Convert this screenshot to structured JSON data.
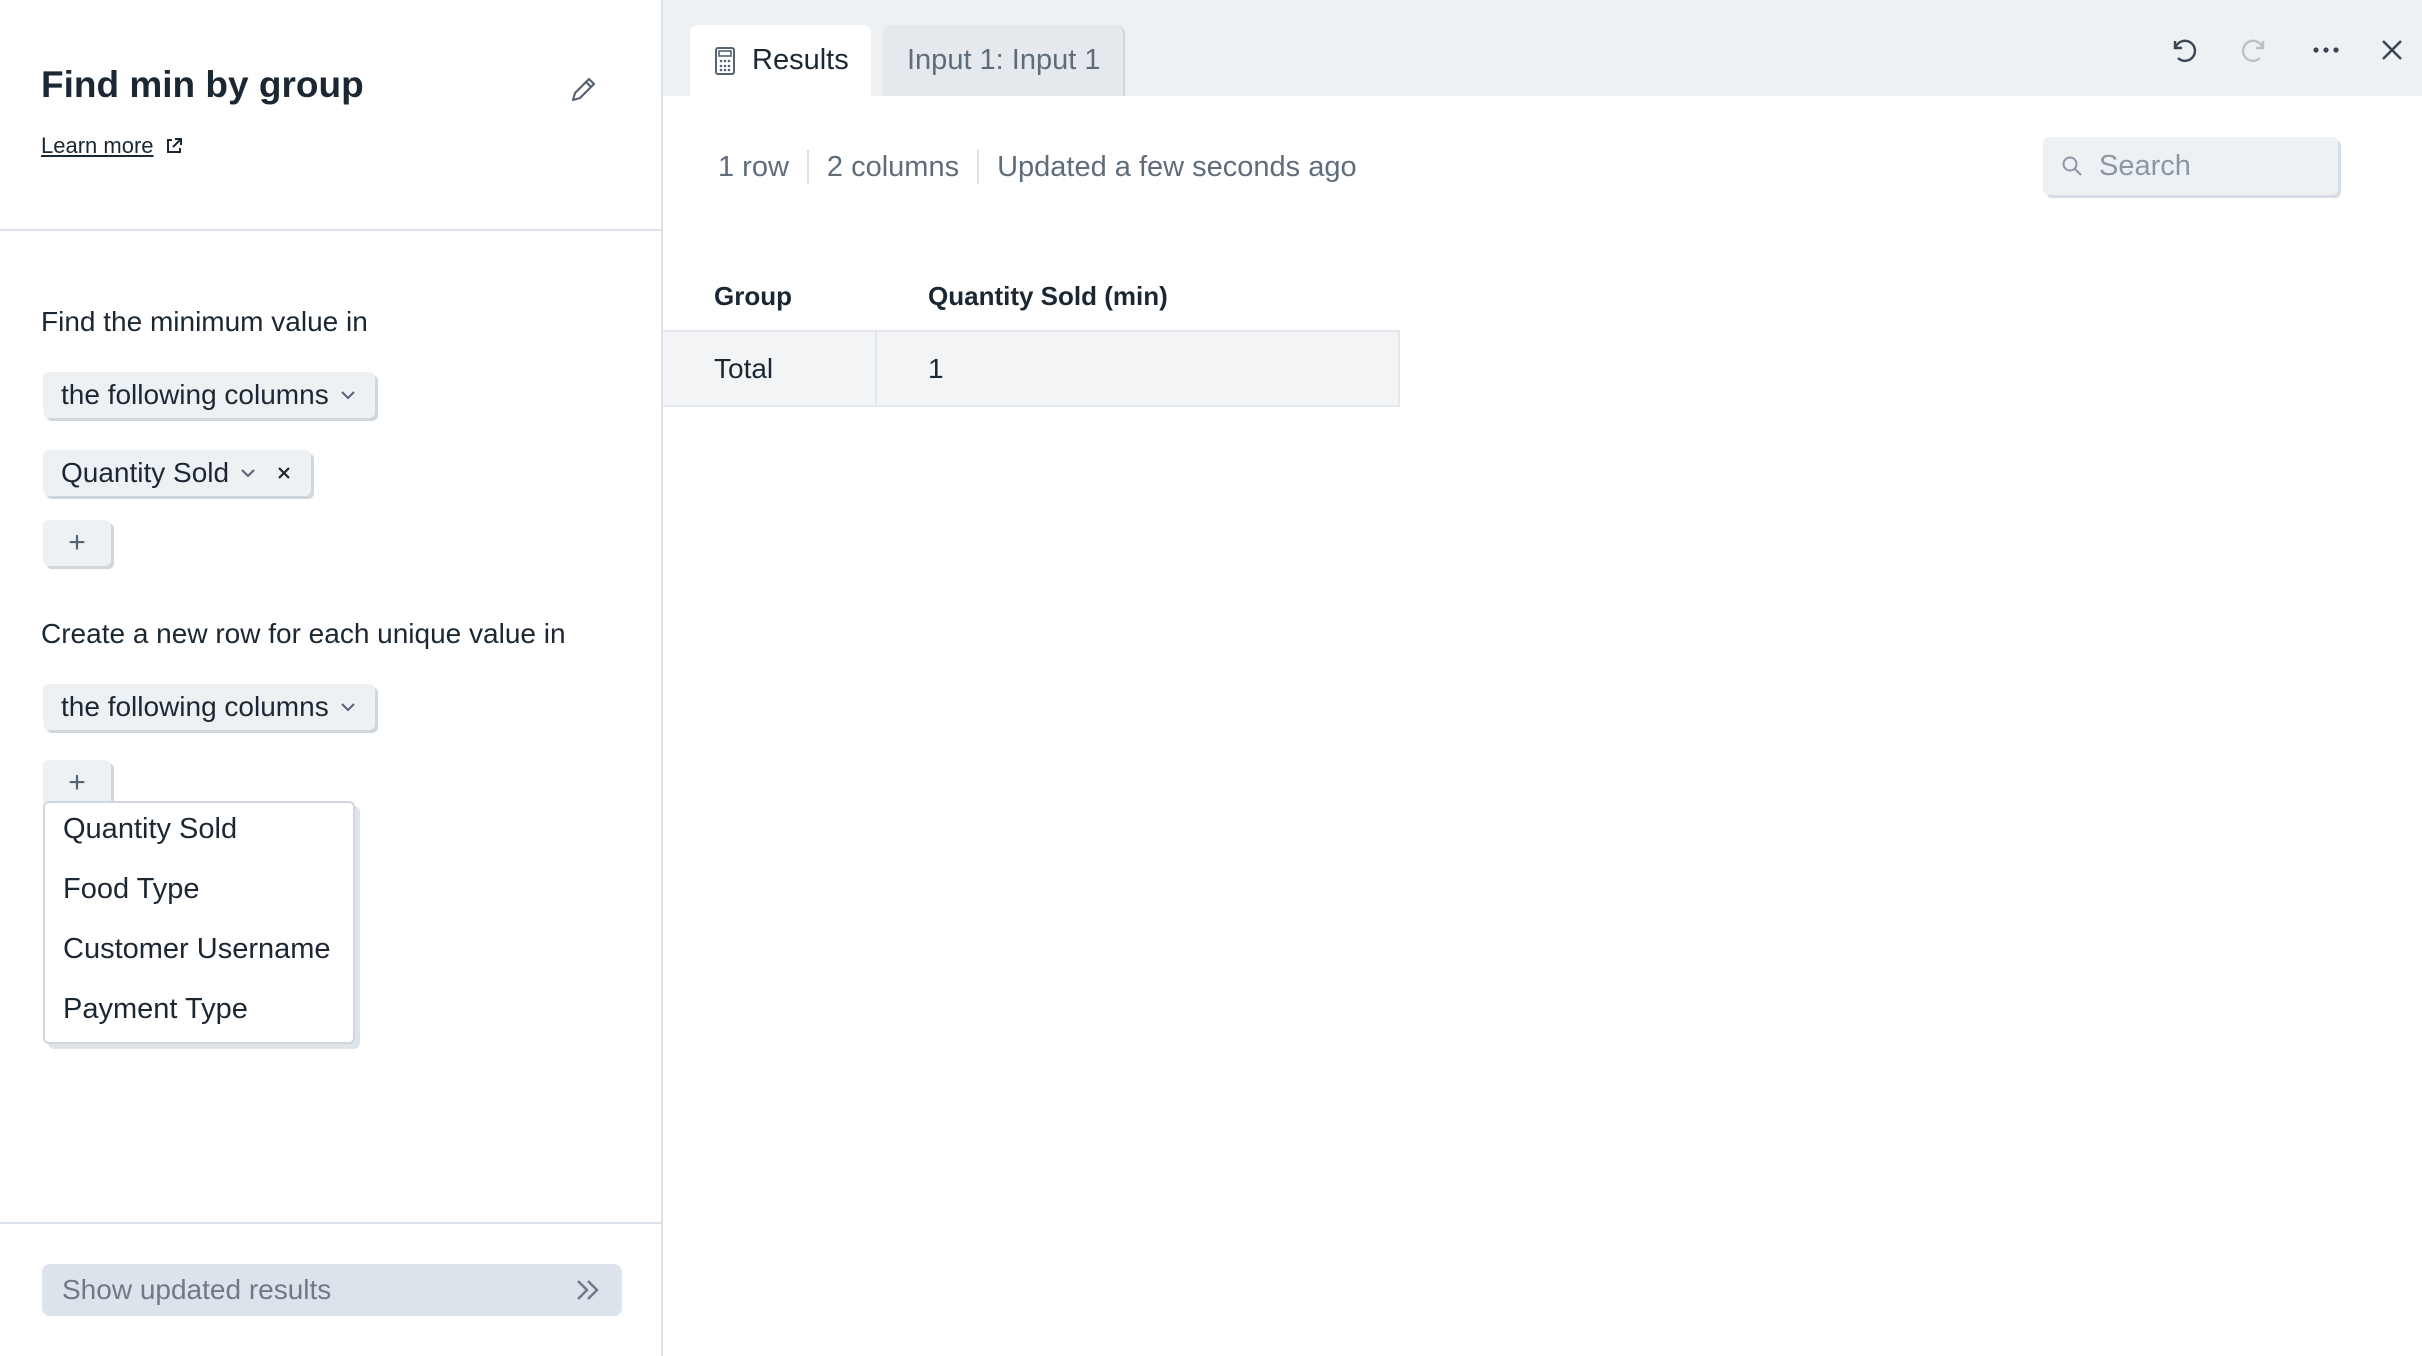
{
  "panel": {
    "title": "Find min by group",
    "learn_more": "Learn more",
    "section1_label": "Find the minimum value in",
    "section1_mode": "the following columns",
    "selected_column": "Quantity Sold",
    "section2_label": "Create a new row for each unique value in",
    "section2_mode": "the following columns",
    "add_symbol": "+",
    "dropdown_options": [
      "Quantity Sold",
      "Food Type",
      "Customer Username",
      "Payment Type"
    ],
    "show_button": "Show updated results"
  },
  "tabs": [
    {
      "label": "Results",
      "icon": "calculator-icon"
    },
    {
      "label": "Input 1: Input 1"
    }
  ],
  "toolbar": {
    "undo": "undo-icon",
    "redo": "redo-icon",
    "more": "more-icon",
    "close": "close-icon"
  },
  "meta": {
    "rows": "1 row",
    "columns": "2 columns",
    "updated": "Updated a few seconds ago"
  },
  "search": {
    "placeholder": "Search"
  },
  "table": {
    "headers": [
      "Group",
      "Quantity Sold (min)"
    ],
    "rows": [
      [
        "Total",
        "1"
      ]
    ]
  },
  "colors": {
    "text": "#1b2733",
    "muted": "#5f6d7b",
    "panel_bg": "#eef1f4",
    "border": "#dde3ea"
  }
}
